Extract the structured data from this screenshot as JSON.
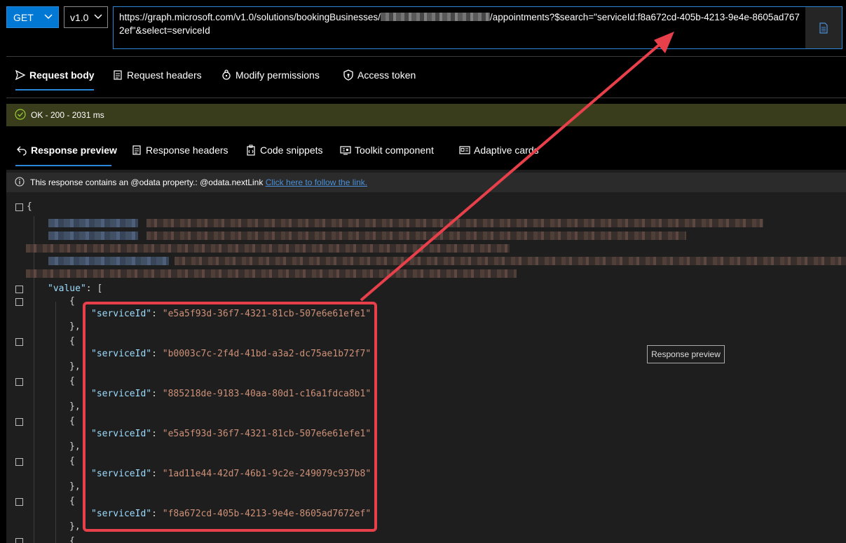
{
  "request": {
    "method": "GET",
    "version": "v1.0",
    "url_prefix": "https://graph.microsoft.com/v1.0/solutions/bookingBusinesses/",
    "url_suffix": "/appointments?$search=\"serviceId:f8a672cd-405b-4213-9e4e-8605ad7672ef\"&select=serviceId"
  },
  "request_tabs": [
    "Request body",
    "Request headers",
    "Modify permissions",
    "Access token"
  ],
  "status": "OK - 200 - 2031 ms",
  "response_tabs": [
    "Response preview",
    "Response headers",
    "Code snippets",
    "Toolkit component",
    "Adaptive cards"
  ],
  "info": {
    "text": "This response contains an @odata property.: @odata.nextLink",
    "link": "Click here to follow the link."
  },
  "code": {
    "open_brace": "{",
    "value_key": "\"value\"",
    "value_open": ": [",
    "item_open": "{",
    "item_close": "},",
    "key_name": "\"serviceId\"",
    "colon": ": ",
    "service_ids": [
      "\"e5a5f93d-36f7-4321-81cb-507e6e61efe1\"",
      "\"b0003c7c-2f4d-41bd-a3a2-dc75ae1b72f7\"",
      "\"885218de-9183-40aa-80d1-c16a1fdca8b1\"",
      "\"e5a5f93d-36f7-4321-81cb-507e6e61efe1\"",
      "\"1ad11e44-42d7-46b1-9c2e-249079c937b8\"",
      "\"f8a672cd-405b-4213-9e4e-8605ad7672ef\""
    ]
  },
  "tooltip": "Response preview",
  "colors": {
    "accent": "#0078d4",
    "status_bg": "#393d1b",
    "annotation": "#e8404a"
  }
}
